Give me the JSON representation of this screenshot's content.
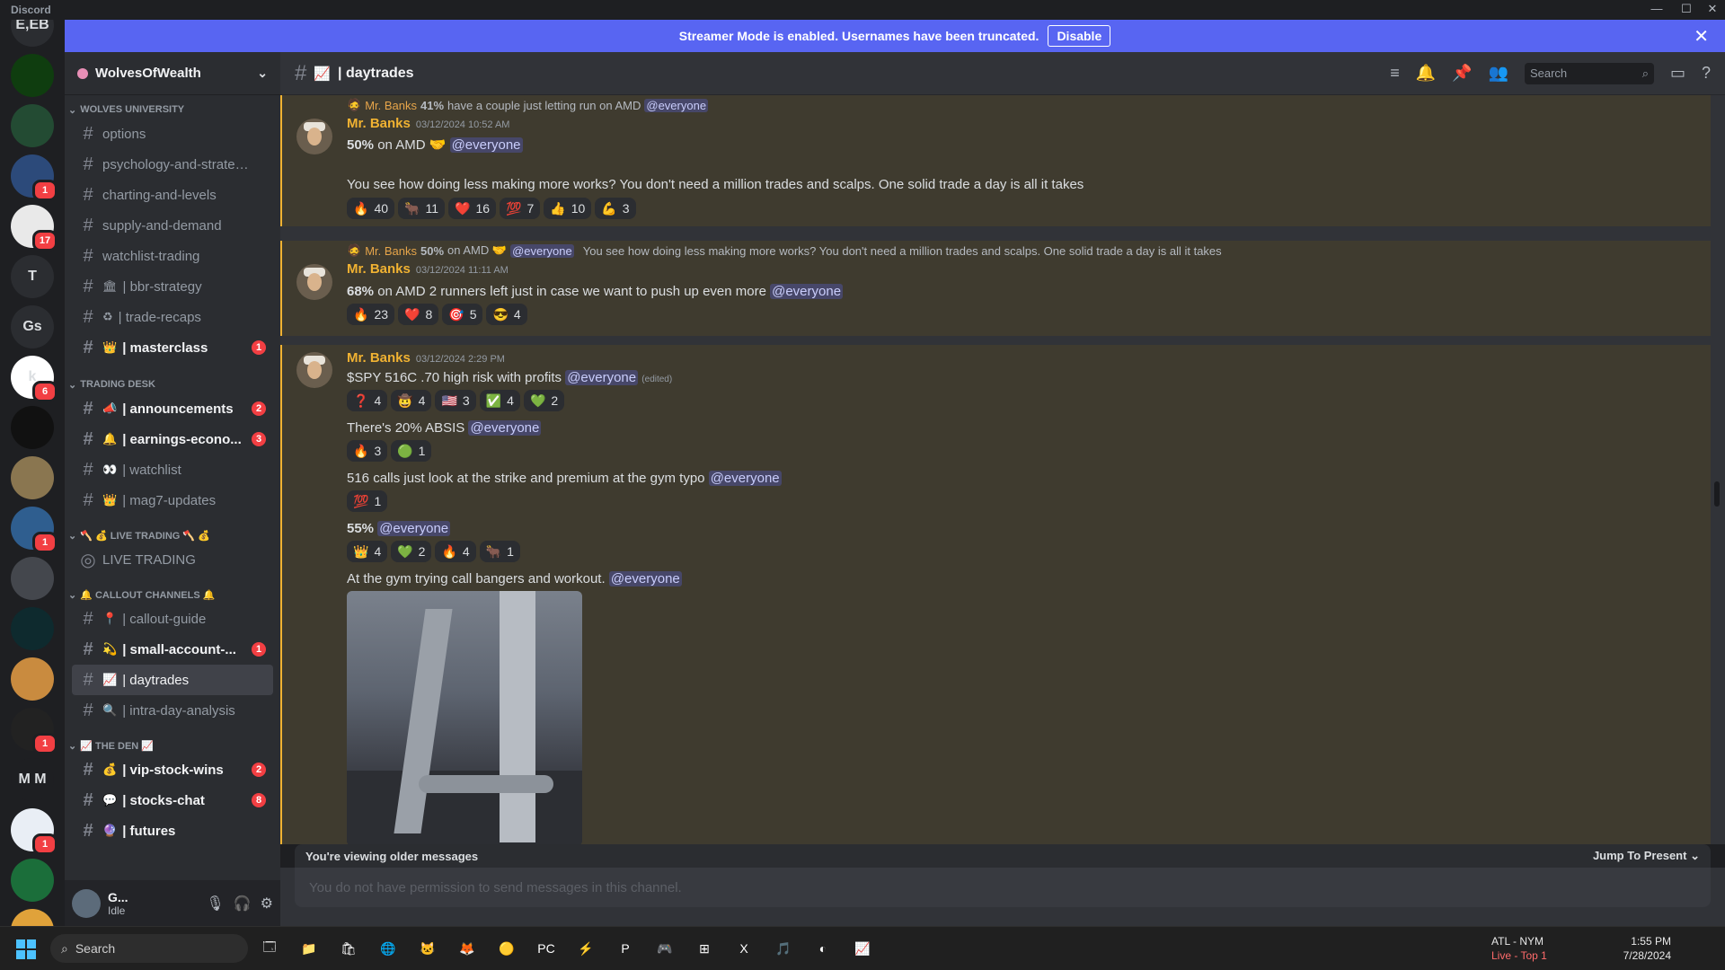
{
  "window": {
    "app_name": "Discord",
    "controls": [
      "—",
      "☐",
      "✕"
    ]
  },
  "banner": {
    "text": "Streamer Mode is enabled. Usernames have been truncated.",
    "button": "Disable",
    "close": "✕"
  },
  "guilds": [
    {
      "label": "E,EB",
      "color": "#2b2d31"
    },
    {
      "label": "",
      "color": "#0f3d0f"
    },
    {
      "label": "",
      "color": "#234b33"
    },
    {
      "label": "",
      "color": "#2c4a7a",
      "badge": "1"
    },
    {
      "label": "",
      "color": "#e9e9e9",
      "badge": "17"
    },
    {
      "label": "T",
      "color": "#2b2d31"
    },
    {
      "label": "Gs",
      "color": "#2b2d31"
    },
    {
      "label": "k",
      "color": "#ffffff",
      "badge": "6"
    },
    {
      "label": "",
      "color": "#111111"
    },
    {
      "label": "",
      "color": "#8a7650"
    },
    {
      "label": "",
      "color": "#2f5e8f",
      "badge": "1"
    },
    {
      "label": "",
      "color": "#44474d"
    },
    {
      "label": "",
      "color": "#0e2a2e"
    },
    {
      "label": "",
      "color": "#c98b3f"
    },
    {
      "label": "",
      "color": "#222222",
      "badge": "1"
    },
    {
      "label": "M M",
      "color": "#1e1f22"
    },
    {
      "label": "",
      "color": "#e9eef5",
      "badge": "1"
    },
    {
      "label": "",
      "color": "#1b6e3a"
    },
    {
      "label": "",
      "color": "#e0a23a"
    }
  ],
  "server": {
    "name": "WolvesOfWealth"
  },
  "categories": {
    "wolves_university": "WOLVES UNIVERSITY",
    "trading_desk": "TRADING DESK",
    "live_trading": "🪓 💰 LIVE TRADING 🪓 💰",
    "callout_channels": "🔔 CALLOUT CHANNELS 🔔",
    "the_den": "📈 THE DEN 📈"
  },
  "channels": {
    "options": "options",
    "psychology": "psychology-and-strategi...",
    "charting": "charting-and-levels",
    "supply": "supply-and-demand",
    "watchlist_trading": "watchlist-trading",
    "bbr": "| bbr-strategy",
    "recaps": "| trade-recaps",
    "masterclass": "| masterclass",
    "announcements": "| announcements",
    "earnings": "| earnings-econo...",
    "watchlist": "| watchlist",
    "mag7": "| mag7-updates",
    "live_trading": "LIVE TRADING",
    "callout_guide": "| callout-guide",
    "small_account": "| small-account-...",
    "daytrades": "| daytrades",
    "intra_day": "| intra-day-analysis",
    "vip": "| vip-stock-wins",
    "stocks_chat": "| stocks-chat",
    "futures": "| futures"
  },
  "channel_badges": {
    "masterclass": "1",
    "announcements": "2",
    "earnings": "3",
    "small_account": "1",
    "vip": "2",
    "stocks_chat": "8"
  },
  "user": {
    "name": "G...",
    "status": "Idle"
  },
  "header": {
    "channel": "| daytrades",
    "search_placeholder": "Search"
  },
  "messages": [
    {
      "reply_author": "Mr. Banks",
      "reply_text_bold": "41%",
      "reply_text": "have a couple just letting run on AMD",
      "reply_mention": "@everyone",
      "author": "Mr. Banks",
      "timestamp": "03/12/2024 10:52 AM",
      "line1_bold": "50%",
      "line1_text": "on AMD 🤝",
      "line1_mention": "@everyone",
      "line2": "You see how doing less making more works? You don't need a million trades and scalps. One solid trade a day is all it takes",
      "reactions": [
        {
          "emoji": "🔥",
          "count": "40"
        },
        {
          "emoji": "🐂",
          "count": "11"
        },
        {
          "emoji": "❤️",
          "count": "16"
        },
        {
          "emoji": "💯",
          "count": "7"
        },
        {
          "emoji": "👍",
          "count": "10"
        },
        {
          "emoji": "💪",
          "count": "3"
        }
      ]
    },
    {
      "reply_author": "Mr. Banks",
      "reply_text_bold": "50%",
      "reply_text": "on AMD 🤝",
      "reply_mention": "@everyone",
      "reply_tail": "You see how doing less making more works? You don't need a million trades and scalps. One solid trade a day is all it takes",
      "author": "Mr. Banks",
      "timestamp": "03/12/2024 11:11 AM",
      "line1_bold": "68%",
      "line1_text": "on AMD 2 runners left just in case we want to push up even more",
      "line1_mention": "@everyone",
      "reactions": [
        {
          "emoji": "🔥",
          "count": "23"
        },
        {
          "emoji": "❤️",
          "count": "8"
        },
        {
          "emoji": "🎯",
          "count": "5"
        },
        {
          "emoji": "😎",
          "count": "4"
        }
      ]
    },
    {
      "author": "Mr. Banks",
      "timestamp": "03/12/2024 2:29 PM",
      "l1_text": "$SPY 516C .70 high risk with profits",
      "l1_mention": "@everyone",
      "l1_edited": "(edited)",
      "r1": [
        {
          "emoji": "❓",
          "count": "4"
        },
        {
          "emoji": "🤠",
          "count": "4"
        },
        {
          "emoji": "🇺🇸",
          "count": "3"
        },
        {
          "emoji": "✅",
          "count": "4"
        },
        {
          "emoji": "💚",
          "count": "2"
        }
      ],
      "l2_text": "There's 20% ABSIS",
      "l2_mention": "@everyone",
      "r2": [
        {
          "emoji": "🔥",
          "count": "3"
        },
        {
          "emoji": "🟢",
          "count": "1"
        }
      ],
      "l3_text": "516 calls just look at the strike and premium at the gym typo",
      "l3_mention": "@everyone",
      "r3": [
        {
          "emoji": "💯",
          "count": "1"
        }
      ],
      "l4_bold": "55%",
      "l4_mention": "@everyone",
      "r4": [
        {
          "emoji": "👑",
          "count": "4"
        },
        {
          "emoji": "💚",
          "count": "2"
        },
        {
          "emoji": "🔥",
          "count": "4"
        },
        {
          "emoji": "🐂",
          "count": "1"
        }
      ],
      "l5_text": "At the gym trying call bangers and workout.",
      "l5_mention": "@everyone"
    }
  ],
  "older_bar": {
    "text": "You're viewing older messages",
    "jump": "Jump To Present"
  },
  "composer": {
    "placeholder": "You do not have permission to send messages in this channel."
  },
  "taskbar": {
    "search": "Search",
    "weather_title": "ATL - NYM",
    "weather_sub": "Live - Top 1",
    "time": "1:55 PM",
    "date": "7/28/2024",
    "apps": [
      "🗔",
      "📁",
      "🛍",
      "🌐",
      "🐱",
      "🦊",
      "🟡",
      "PC",
      "⚡",
      "P",
      "🎮",
      "⊞",
      "X",
      "🎵",
      "◐",
      "📈"
    ]
  },
  "colors": {
    "accent": "#5865f2",
    "highlight_bg": "#3f3b2f",
    "highlight_border": "#f0b232",
    "author": "#f0b232",
    "badge": "#f23f43"
  }
}
